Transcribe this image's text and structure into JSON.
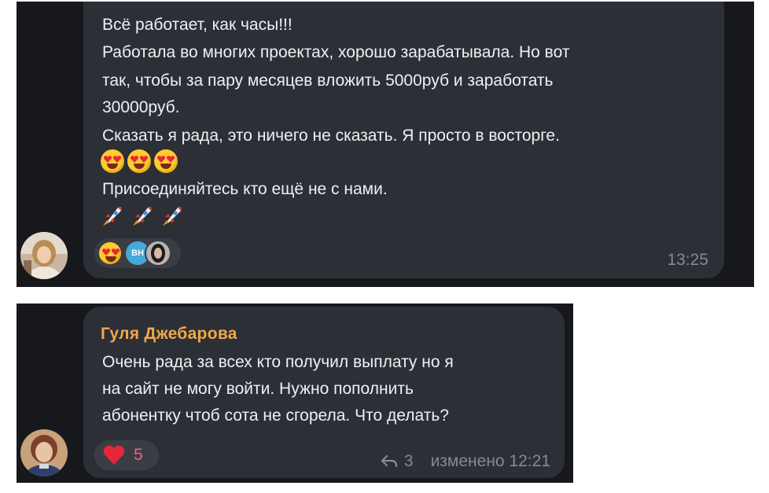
{
  "message1": {
    "lines": [
      "Всё работает, как часы!!!",
      "Работала во многих проектах, хорошо зарабатывала. Но вот",
      "так, чтобы за пару месяцев вложить 5000руб и заработать",
      "30000руб.",
      "Сказать я рада, это ничего не сказать. Я просто в восторге.",
      "Присоединяйтесь кто ещё не с нами."
    ],
    "emoji_row_1": [
      "heart-eyes-emoji",
      "heart-eyes-emoji",
      "heart-eyes-emoji"
    ],
    "emoji_row_2": [
      "rocket-emoji",
      "rocket-emoji",
      "rocket-emoji"
    ],
    "reactions": {
      "emoji": "heart-eyes-emoji",
      "badge": "ВН"
    },
    "time": "13:25"
  },
  "message2": {
    "sender": "Гуля Джебарова",
    "lines": [
      "Очень рада за всех кто получил выплату но я",
      "на сайт не могу войти. Нужно пополнить",
      "абонентку чтоб сота не сгорела. Что делать?"
    ],
    "reactions": {
      "emoji": "red-heart-emoji",
      "count": "5"
    },
    "replies": "3",
    "edited_time": "изменено 12:21"
  },
  "colors": {
    "panel_bg": "#17181b",
    "bubble_bg": "#2d2f36",
    "text": "#eef0f3",
    "sender_name": "#f0a84a",
    "meta_text": "#858994",
    "reaction_pill": "#3b3d45",
    "badge_blue": "#45a9d9"
  }
}
